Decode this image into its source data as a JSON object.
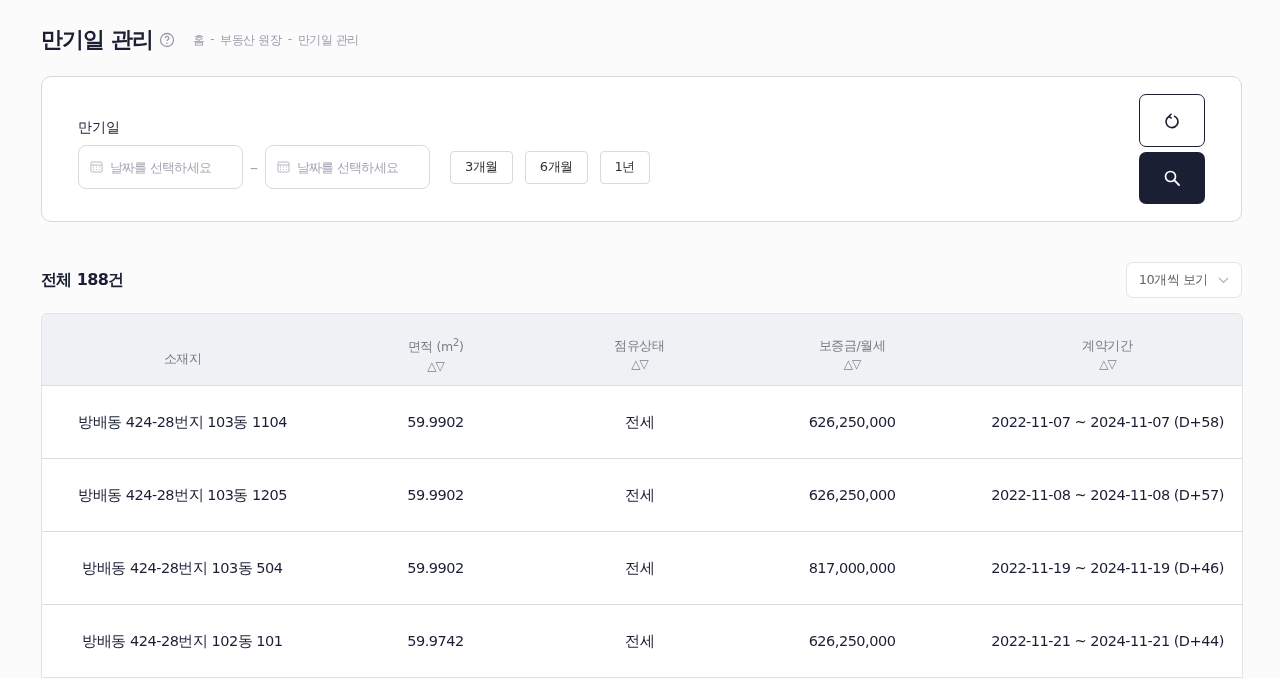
{
  "page": {
    "title": "만기일 관리",
    "breadcrumb": [
      "홈",
      "부동산 원장",
      "만기일 관리"
    ],
    "breadcrumb_separator": "-"
  },
  "filter": {
    "label": "만기일",
    "date_from": {
      "placeholder": "날짜를 선택하세요"
    },
    "range_separator": "–",
    "date_to": {
      "placeholder": "날짜를 선택하세요"
    },
    "presets": [
      "3개월",
      "6개월",
      "1년"
    ]
  },
  "summary": {
    "total": "전체 188건",
    "page_size": "10개씩 보기"
  },
  "table": {
    "columns": [
      {
        "label": "소재지"
      },
      {
        "label": "면적 (m$^{2}$)",
        "sort": "△▽"
      },
      {
        "label": "점유상태",
        "sort": "△▽"
      },
      {
        "label": "보증금/월세",
        "sort": "△▽"
      },
      {
        "label": "계약기간",
        "sort": "△▽"
      }
    ],
    "rows": [
      [
        "방배동 424-28번지 103동 1104",
        "59.9902",
        "전세",
        "626,250,000",
        "2022-11-07 ~ 2024-11-07 (D+58)"
      ],
      [
        "방배동 424-28번지 103동 1205",
        "59.9902",
        "전세",
        "626,250,000",
        "2022-11-08 ~ 2024-11-08 (D+57)"
      ],
      [
        "방배동 424-28번지 103동 504",
        "59.9902",
        "전세",
        "817,000,000",
        "2022-11-19 ~ 2024-11-19 (D+46)"
      ],
      [
        "방배동 424-28번지 102동 101",
        "59.9742",
        "전세",
        "626,250,000",
        "2022-11-21 ~ 2024-11-21 (D+44)"
      ]
    ]
  }
}
